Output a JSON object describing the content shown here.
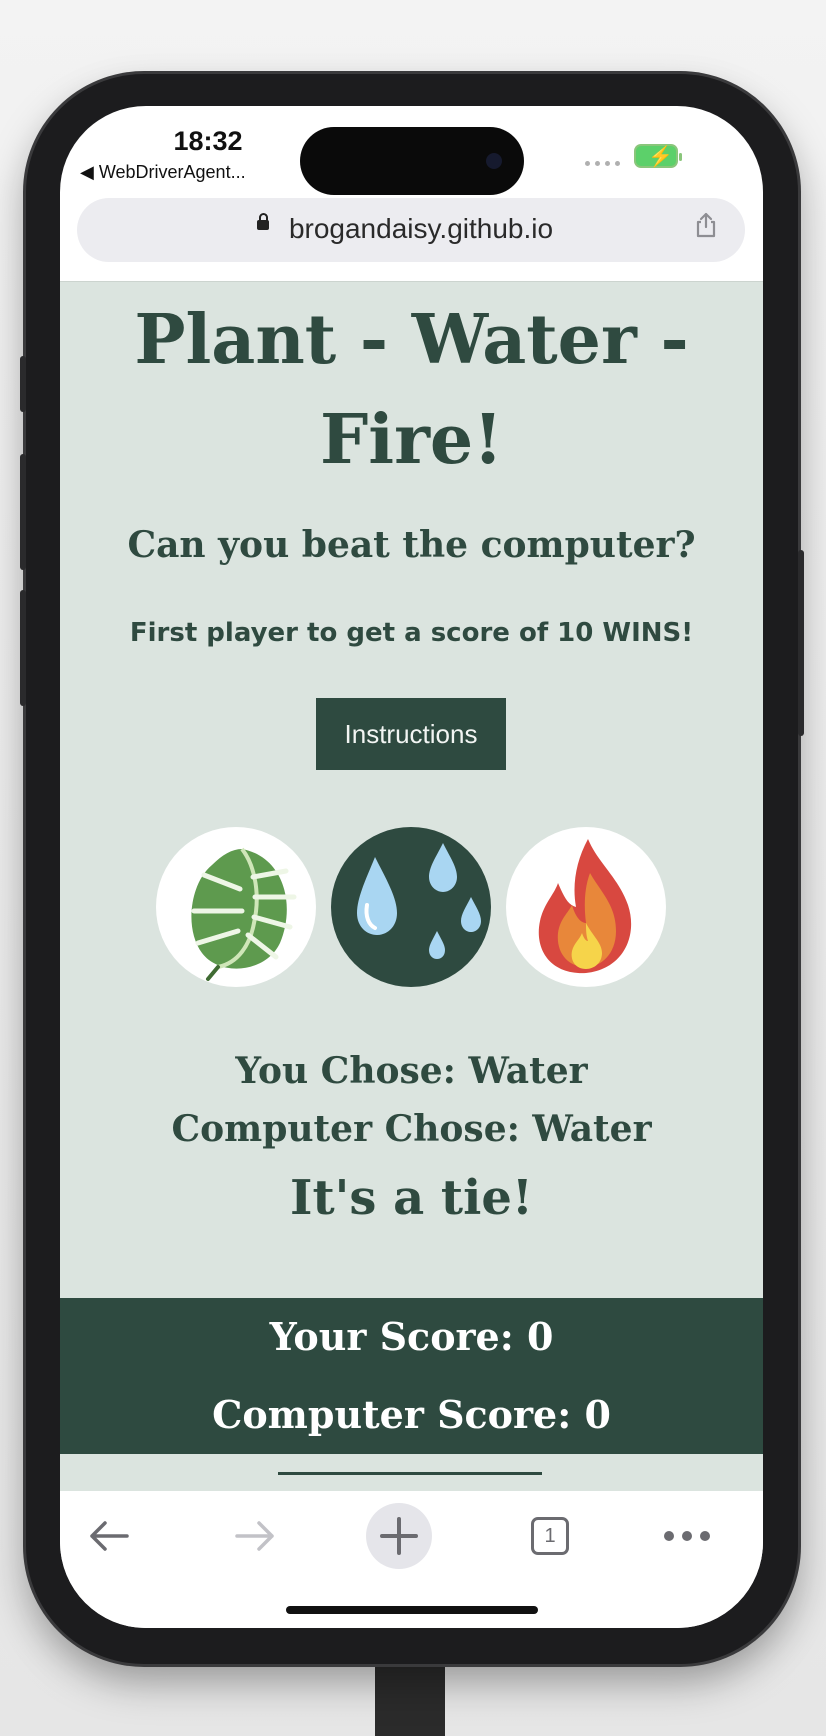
{
  "status": {
    "time": "18:32",
    "back_app": "◀ WebDriverAgent..."
  },
  "browser": {
    "url": "brogandaisy.github.io"
  },
  "page": {
    "title_line1": "Plant - Water -",
    "title_line2": "Fire!",
    "subtitle": "Can you beat the computer?",
    "rule": "First player to get a score of 10 WINS!",
    "instructions_label": "Instructions",
    "choices": [
      {
        "name": "Plant",
        "icon": "monstera-leaf-icon"
      },
      {
        "name": "Water",
        "icon": "water-drops-icon"
      },
      {
        "name": "Fire",
        "icon": "flame-icon"
      }
    ],
    "you_chose": "You Chose: Water",
    "computer_chose": "Computer Chose: Water",
    "outcome": "It's a tie!",
    "your_score": "Your Score: 0",
    "computer_score": "Computer Score: 0"
  },
  "toolbar": {
    "tab_count": "1"
  },
  "colors": {
    "page_background": "#dbe4df",
    "accent_dark_green": "#2e4a40",
    "battery_green": "#5cd06a"
  }
}
